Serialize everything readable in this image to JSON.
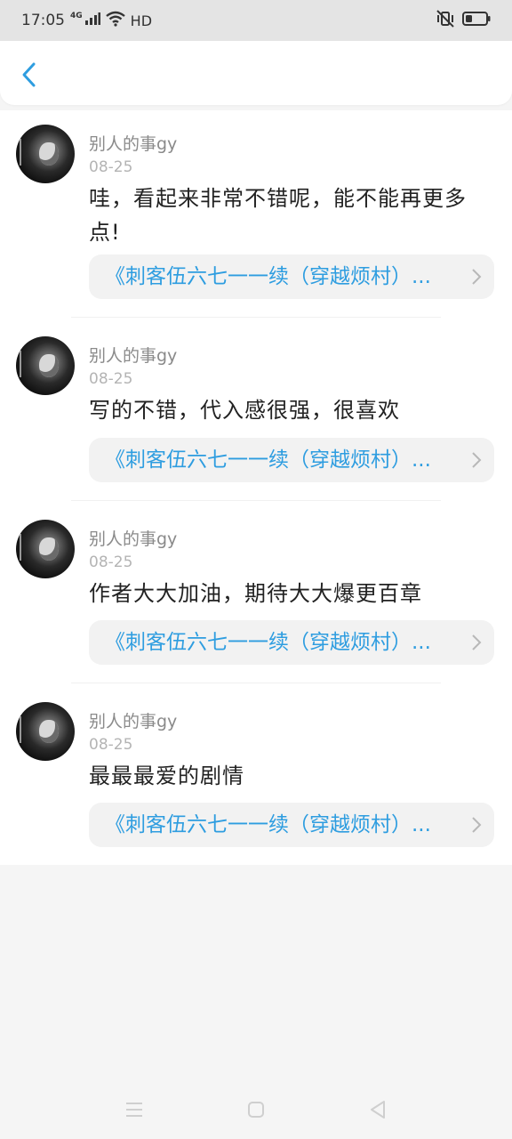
{
  "status_bar": {
    "time": "17:05",
    "network": "4G",
    "hd_label": "HD"
  },
  "header": {
    "back_icon": "chevron-left-icon"
  },
  "comments": [
    {
      "username": "别人的事gy",
      "date": "08-25",
      "text": "哇，看起来非常不错呢，能不能再更多点!",
      "book": "《刺客伍六七一一续（穿越烦村）..."
    },
    {
      "username": "别人的事gy",
      "date": "08-25",
      "text": "写的不错，代入感很强，很喜欢",
      "book": "《刺客伍六七一一续（穿越烦村）..."
    },
    {
      "username": "别人的事gy",
      "date": "08-25",
      "text": "作者大大加油，期待大大爆更百章",
      "book": "《刺客伍六七一一续（穿越烦村）..."
    },
    {
      "username": "别人的事gy",
      "date": "08-25",
      "text": "最最最爱的剧情",
      "book": "《刺客伍六七一一续（穿越烦村）..."
    }
  ],
  "colors": {
    "accent": "#2e9de0",
    "username": "#8a8a8a",
    "date": "#b4b4b4",
    "text": "#222222"
  },
  "nav_bar": {
    "icons": [
      "menu-icon",
      "home-square-icon",
      "back-triangle-icon"
    ]
  }
}
